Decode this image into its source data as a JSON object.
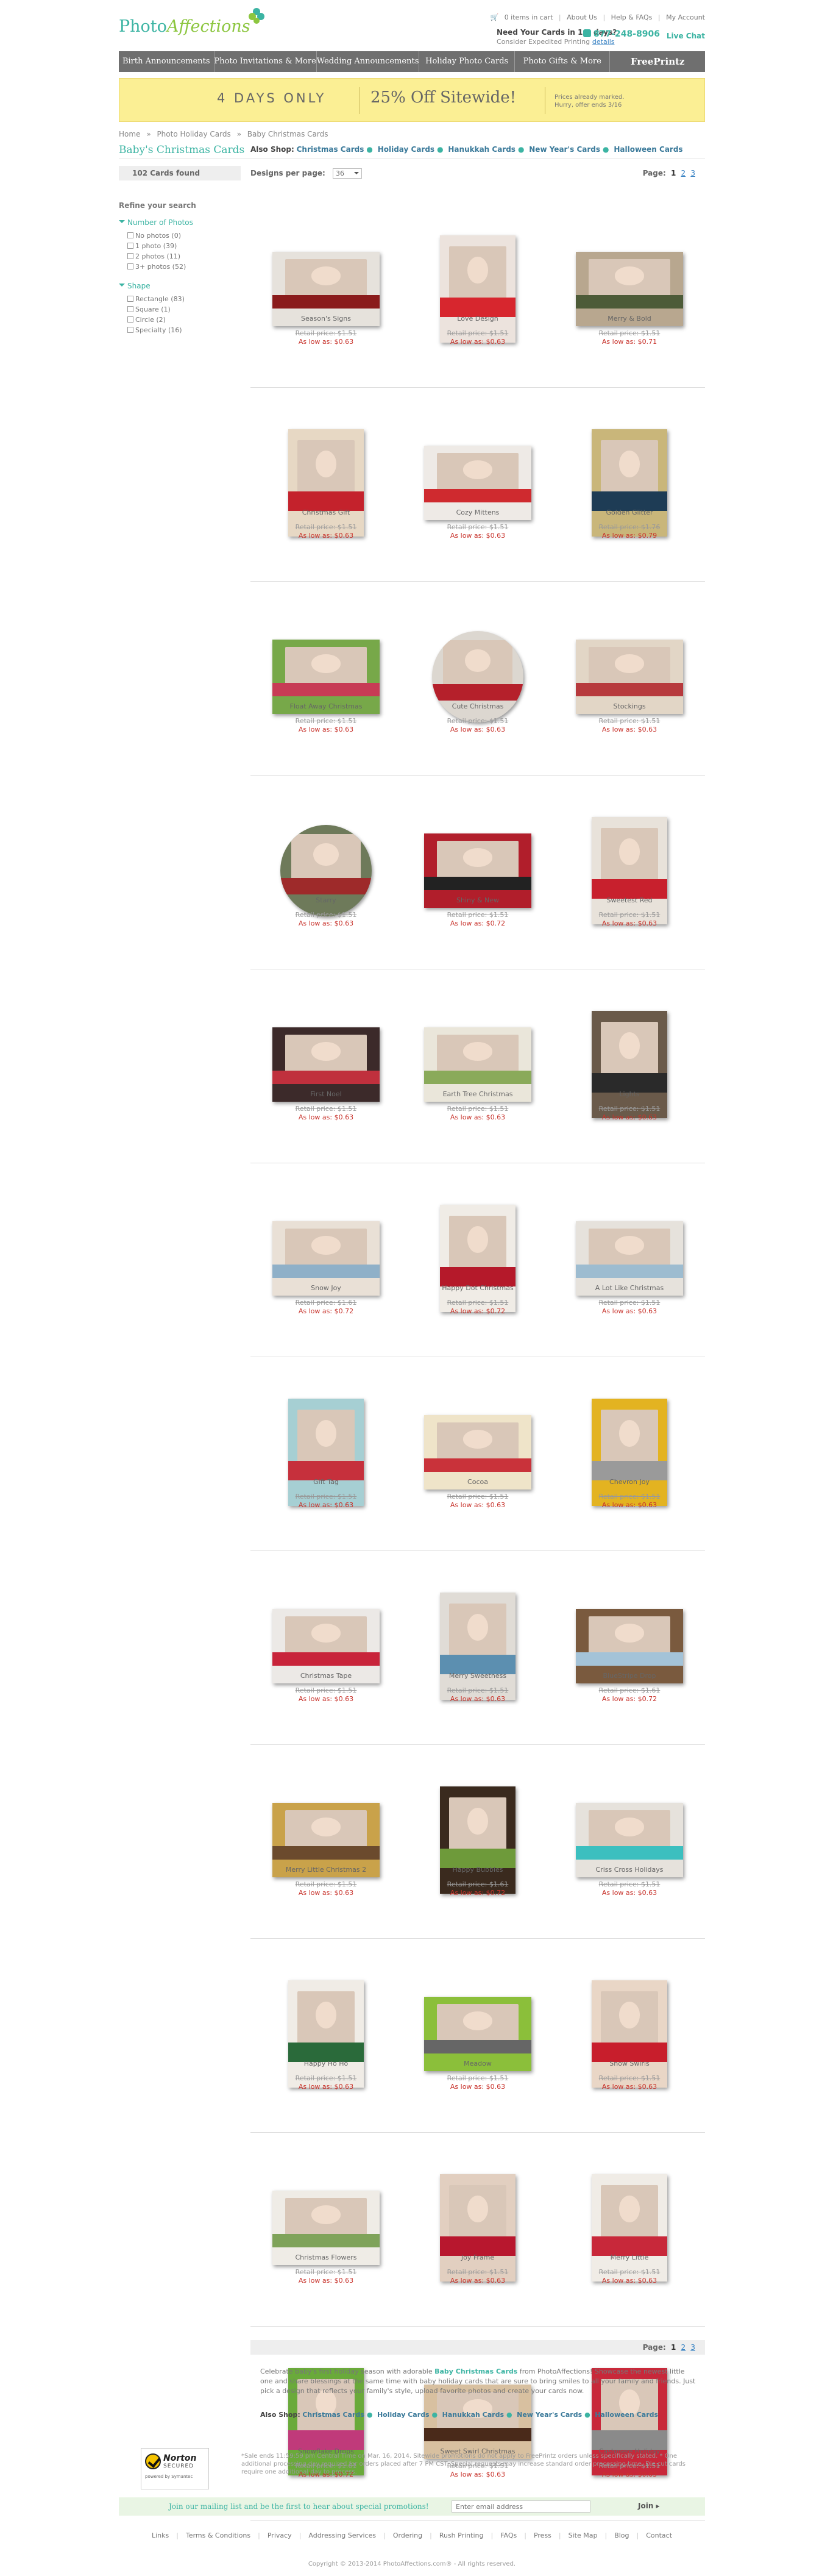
{
  "header": {
    "logo_part1": "Photo",
    "logo_part2": "Affections",
    "cart": "0 items in cart",
    "about": "About Us",
    "help": "Help & FAQs",
    "account": "My Account",
    "need_title": "Need Your Cards in 1-2 days?",
    "need_sub": "Consider Expedited Printing",
    "details": "details",
    "phone": "877-248-8906",
    "live_chat": "Live Chat"
  },
  "nav": [
    "Birth Announcements",
    "Photo Invitations & More",
    "Wedding Announcements",
    "Holiday Photo Cards",
    "Photo Gifts & More",
    "FreePrintz"
  ],
  "promo": {
    "left": "4 DAYS ONLY",
    "center": "25% Off Sitewide!",
    "right1": "Prices already marked.",
    "right2": "Hurry, offer ends 3/16"
  },
  "breadcrumb": [
    "Home",
    "»",
    "Photo Holiday Cards",
    "»",
    "Baby Christmas Cards"
  ],
  "page_title": "Baby's Christmas Cards",
  "also_shop": {
    "label": "Also Shop:",
    "links": [
      "Christmas Cards",
      "Holiday Cards",
      "Hanukkah Cards",
      "New Year's Cards",
      "Halloween Cards"
    ]
  },
  "toolbar": {
    "count": "102 Cards found",
    "per_page_label": "Designs per page:",
    "per_page_value": "36",
    "page_label": "Page:",
    "pages": [
      "1",
      "2",
      "3"
    ]
  },
  "sidebar": {
    "heading": "Refine your search",
    "groups": [
      {
        "title": "Number of Photos",
        "options": [
          "No photos (0)",
          "1 photo (39)",
          "2 photos (11)",
          "3+ photos (52)"
        ]
      },
      {
        "title": "Shape",
        "options": [
          "Rectangle (83)",
          "Square (1)",
          "Circle (2)",
          "Specialty (16)"
        ]
      }
    ]
  },
  "price_retail_label": "Retail price:",
  "price_low_label": "As low as:",
  "products": [
    {
      "name": "Season's Signs",
      "retail": "$1.51",
      "low": "$0.63",
      "shape": "land",
      "c1": "#8a1b1b",
      "c2": "#e6e2dc"
    },
    {
      "name": "Love Design",
      "retail": "$1.51",
      "low": "$0.63",
      "shape": "port",
      "c1": "#d7262e",
      "c2": "#ece3dd"
    },
    {
      "name": "Merry & Bold",
      "retail": "$1.51",
      "low": "$0.71",
      "shape": "land",
      "c1": "#4d5b38",
      "c2": "#b8a78f"
    },
    {
      "name": "Christmas Gift",
      "retail": "$1.51",
      "low": "$0.63",
      "shape": "port",
      "c1": "#c4222c",
      "c2": "#e7d8c4"
    },
    {
      "name": "Cozy Mittens",
      "retail": "$1.51",
      "low": "$0.63",
      "shape": "land",
      "c1": "#cf2a2f",
      "c2": "#eeeae6"
    },
    {
      "name": "Golden Glitter",
      "retail": "$1.76",
      "low": "$0.79",
      "shape": "port",
      "c1": "#1e3c55",
      "c2": "#c9b67a"
    },
    {
      "name": "Float Away Christmas",
      "retail": "$1.51",
      "low": "$0.63",
      "shape": "land",
      "c1": "#c73b55",
      "c2": "#77a849"
    },
    {
      "name": "Cute Christmas",
      "retail": "$1.51",
      "low": "$0.63",
      "shape": "round",
      "c1": "#b5202b",
      "c2": "#dcd7d0"
    },
    {
      "name": "Stockings",
      "retail": "$1.51",
      "low": "$0.63",
      "shape": "land",
      "c1": "#b73a3d",
      "c2": "#e2d6c6"
    },
    {
      "name": "Starry",
      "retail": "$1.51",
      "low": "$0.63",
      "shape": "round",
      "c1": "#9e2a2a",
      "c2": "#6e7a5a"
    },
    {
      "name": "Shiny & New",
      "retail": "$1.51",
      "low": "$0.72",
      "shape": "land",
      "c1": "#222222",
      "c2": "#b11e2b"
    },
    {
      "name": "Sweetest Red",
      "retail": "$1.51",
      "low": "$0.63",
      "shape": "port",
      "c1": "#c8202d",
      "c2": "#e8e2da"
    },
    {
      "name": "First Noel",
      "retail": "$1.51",
      "low": "$0.63",
      "shape": "land",
      "c1": "#c0303d",
      "c2": "#3c2a2a"
    },
    {
      "name": "Earth Tree Christmas",
      "retail": "$1.51",
      "low": "$0.63",
      "shape": "land",
      "c1": "#8aaa5a",
      "c2": "#eae6da"
    },
    {
      "name": "Lights",
      "retail": "$1.51",
      "low": "$0.63",
      "shape": "port",
      "c1": "#2a2a2a",
      "c2": "#6a5a4a"
    },
    {
      "name": "Snow Joy",
      "retail": "$1.61",
      "low": "$0.72",
      "shape": "land",
      "c1": "#8fb0c8",
      "c2": "#e9e0d6"
    },
    {
      "name": "Happy Dot Christmas",
      "retail": "$1.51",
      "low": "$0.72",
      "shape": "port",
      "c1": "#b5192a",
      "c2": "#f0ece6"
    },
    {
      "name": "A Lot Like Christmas",
      "retail": "$1.51",
      "low": "$0.63",
      "shape": "land",
      "c1": "#9dbcd0",
      "c2": "#e6e2dc"
    },
    {
      "name": "Gift Tag",
      "retail": "$1.51",
      "low": "$0.63",
      "shape": "port",
      "c1": "#c6303c",
      "c2": "#a6cfd3"
    },
    {
      "name": "Cocoa",
      "retail": "$1.51",
      "low": "$0.63",
      "shape": "land",
      "c1": "#c9323a",
      "c2": "#efe4c9"
    },
    {
      "name": "Chevron Joy",
      "retail": "$1.51",
      "low": "$0.63",
      "shape": "port",
      "c1": "#9a9a9a",
      "c2": "#e3b321"
    },
    {
      "name": "Christmas Tape",
      "retail": "$1.51",
      "low": "$0.63",
      "shape": "land",
      "c1": "#c8243a",
      "c2": "#ece9e6"
    },
    {
      "name": "Merry Sweetness",
      "retail": "$1.51",
      "low": "$0.63",
      "shape": "port",
      "c1": "#5c8fb0",
      "c2": "#e0dcd6"
    },
    {
      "name": "BlueStripe Drop",
      "retail": "$1.61",
      "low": "$0.72",
      "shape": "land",
      "c1": "#a4c3d8",
      "c2": "#7a5a3e"
    },
    {
      "name": "Merry Little Christmas 2",
      "retail": "$1.51",
      "low": "$0.63",
      "shape": "land",
      "c1": "#6b4a2d",
      "c2": "#c9a24a"
    },
    {
      "name": "Happy Bubbles",
      "retail": "$1.61",
      "low": "$0.72",
      "shape": "port",
      "c1": "#6e9a3a",
      "c2": "#3a2a1e"
    },
    {
      "name": "Criss Cross Holidays",
      "retail": "$1.51",
      "low": "$0.63",
      "shape": "land",
      "c1": "#3cbfbf",
      "c2": "#e6e2dc"
    },
    {
      "name": "Happy Ho Ho",
      "retail": "$1.51",
      "low": "$0.63",
      "shape": "port",
      "c1": "#2a6a3a",
      "c2": "#f0ece6"
    },
    {
      "name": "Meadow",
      "retail": "$1.51",
      "low": "$0.63",
      "shape": "land",
      "c1": "#666666",
      "c2": "#8bbf3a"
    },
    {
      "name": "Snow Swirls",
      "retail": "$1.51",
      "low": "$0.63",
      "shape": "port",
      "c1": "#c81e2c",
      "c2": "#e9d6c6"
    },
    {
      "name": "Christmas Flowers",
      "retail": "$1.51",
      "low": "$0.63",
      "shape": "land",
      "c1": "#7fa35a",
      "c2": "#efece6"
    },
    {
      "name": "Joy Frame",
      "retail": "$1.51",
      "low": "$0.63",
      "shape": "port",
      "c1": "#b8172e",
      "c2": "#e2cfc0"
    },
    {
      "name": "Merry Little",
      "retail": "$1.51",
      "low": "$0.63",
      "shape": "port",
      "c1": "#c8283a",
      "c2": "#f0ece6"
    },
    {
      "name": "Snowflake Drops",
      "retail": "$1.61",
      "low": "$0.72",
      "shape": "port",
      "c1": "#c03a7a",
      "c2": "#6aaa3a"
    },
    {
      "name": "Sweet Swirl Christmas",
      "retail": "$1.51",
      "low": "$0.63",
      "shape": "land",
      "c1": "#4a2a1a",
      "c2": "#d8c0a0"
    },
    {
      "name": "Cashmere Holiday",
      "retail": "$1.51",
      "low": "$0.63",
      "shape": "port",
      "c1": "#8a8a8a",
      "c2": "#c8283a"
    }
  ],
  "description": {
    "pre": "Celebrate baby's first holiday season with adorable ",
    "bold": "Baby Christmas Cards",
    "post": " from PhotoAffections! Showcase the newest little one and share blessings at the same time with baby holiday cards that are sure to bring smiles to all your family and friends. Just pick a design that reflects your family's style, upload favorite photos and create your cards now."
  },
  "norton": {
    "name": "Norton",
    "secured": "SECURED",
    "powered": "powered by Symantec"
  },
  "fine_print": "*Sale ends 11:59:59 pm Central Time on Mar. 16, 2014. Sitewide promotions do not apply to FreePrintz orders unless specifically stated. * One additional processing day required for orders placed after 7 PM CST. Special requests may increase standard order processing time. Die cut cards require one additional day to process.",
  "mailing": {
    "text": "Join our mailing list and be the first to hear about special promotions!",
    "placeholder": "Enter email address",
    "join": "Join ▸"
  },
  "footer_links": [
    "Links",
    "Terms & Conditions",
    "Privacy",
    "Addressing Services",
    "Ordering",
    "Rush Printing",
    "FAQs",
    "Press",
    "Site Map",
    "Blog",
    "Contact"
  ],
  "copyright": "Copyright © 2013-2014 PhotoAffections.com® - All rights reserved."
}
